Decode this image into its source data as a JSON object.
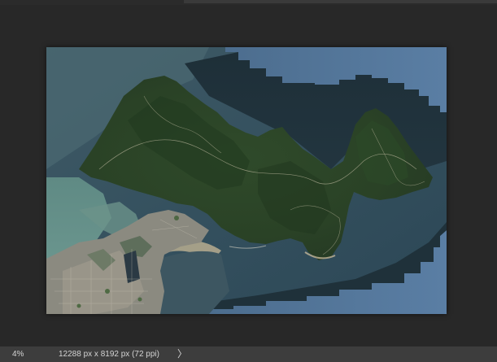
{
  "status_bar": {
    "zoom": "4%",
    "document_info": "12288 px x 8192 px (72 ppi)",
    "info_menu_arrow": "〉"
  },
  "canvas": {
    "background_color": "#282828",
    "image_subject": "satellite-image-island"
  }
}
